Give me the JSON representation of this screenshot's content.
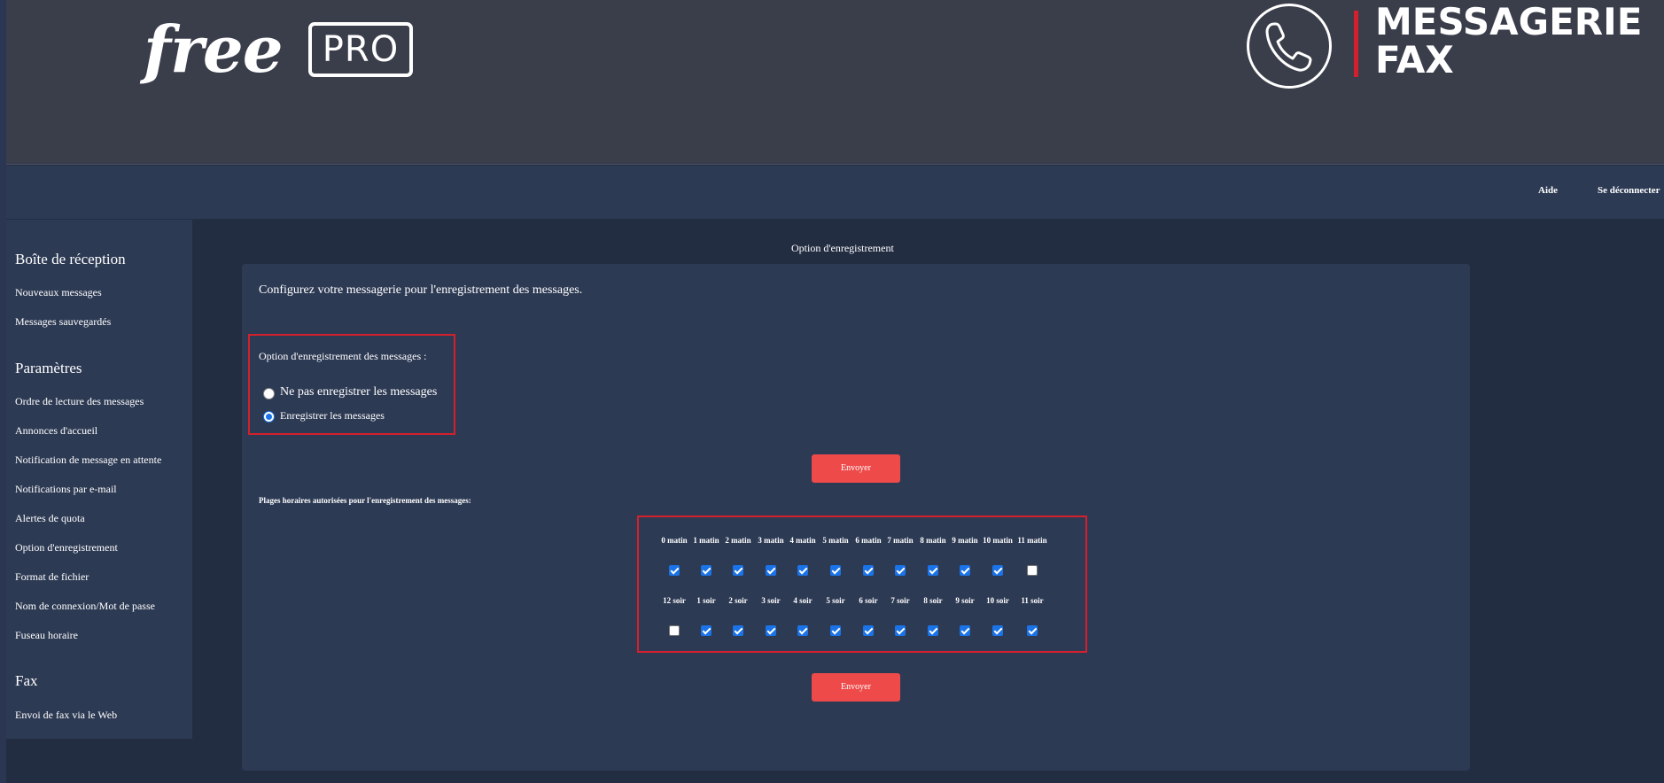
{
  "header": {
    "logo_free": "free",
    "logo_pro": "PRO",
    "brand_line1": "MESSAGERIE",
    "brand_line2": "FAX"
  },
  "nav": {
    "help": "Aide",
    "logout": "Se déconnecter"
  },
  "sidebar": {
    "sections": [
      {
        "title": "Boîte de réception",
        "items": [
          "Nouveaux messages",
          "Messages sauvegardés"
        ]
      },
      {
        "title": "Paramètres",
        "items": [
          "Ordre de lecture des messages",
          "Annonces d'accueil",
          "Notification de message en attente",
          "Notifications par e-mail",
          "Alertes de quota",
          "Option d'enregistrement",
          "Format de fichier",
          "Nom de connexion/Mot de passe",
          "Fuseau horaire"
        ]
      },
      {
        "title": "Fax",
        "items": [
          "Envoi de fax via le Web"
        ]
      }
    ]
  },
  "main": {
    "title": "Option d'enregistrement",
    "intro": "Configurez votre messagerie pour l'enregistrement des messages.",
    "option_label": "Option d'enregistrement des messages :",
    "options": [
      {
        "label": "Ne pas enregistrer les messages",
        "selected": false
      },
      {
        "label": "Enregistrer les messages",
        "selected": true
      }
    ],
    "submit_label": "Envoyer",
    "plages_label": "Plages horaires autorisées pour l'enregistrement des messages:",
    "morning_hours": [
      {
        "label": "0 matin",
        "checked": true
      },
      {
        "label": "1 matin",
        "checked": true
      },
      {
        "label": "2 matin",
        "checked": true
      },
      {
        "label": "3 matin",
        "checked": true
      },
      {
        "label": "4 matin",
        "checked": true
      },
      {
        "label": "5 matin",
        "checked": true
      },
      {
        "label": "6 matin",
        "checked": true
      },
      {
        "label": "7 matin",
        "checked": true
      },
      {
        "label": "8 matin",
        "checked": true
      },
      {
        "label": "9 matin",
        "checked": true
      },
      {
        "label": "10 matin",
        "checked": true
      },
      {
        "label": "11 matin",
        "checked": false
      }
    ],
    "evening_hours": [
      {
        "label": "12 soir",
        "checked": false
      },
      {
        "label": "1 soir",
        "checked": true
      },
      {
        "label": "2 soir",
        "checked": true
      },
      {
        "label": "3 soir",
        "checked": true
      },
      {
        "label": "4 soir",
        "checked": true
      },
      {
        "label": "5 soir",
        "checked": true
      },
      {
        "label": "6 soir",
        "checked": true
      },
      {
        "label": "7 soir",
        "checked": true
      },
      {
        "label": "8 soir",
        "checked": true
      },
      {
        "label": "9 soir",
        "checked": true
      },
      {
        "label": "10 soir",
        "checked": true
      },
      {
        "label": "11 soir",
        "checked": true
      }
    ],
    "submit_label_2": "Envoyer"
  },
  "colors": {
    "accent_red": "#ef4a4a",
    "highlight_red": "#d4202c",
    "checkbox_blue": "#1a73e8",
    "panel_bg": "#2d3a54",
    "page_bg": "#232d42"
  }
}
